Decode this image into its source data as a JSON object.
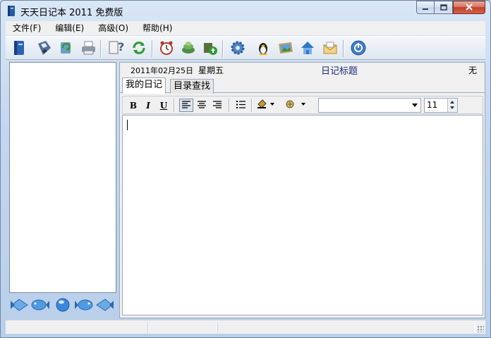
{
  "window": {
    "title": "天天日记本 2011 免费版",
    "controls": {
      "minimize_icon": "minimize-icon",
      "maximize_icon": "maximize-icon",
      "close_icon": "close-icon"
    }
  },
  "menu": [
    {
      "label": "文件(F)"
    },
    {
      "label": "编辑(E)"
    },
    {
      "label": "高级(O)"
    },
    {
      "label": "帮助(H)"
    }
  ],
  "toolbar": {
    "buttons": [
      {
        "icon": "diary-book-icon"
      },
      {
        "icon": "save-disk-icon"
      },
      {
        "icon": "refresh-disk-icon"
      },
      {
        "icon": "printer-icon"
      },
      {
        "icon": "help-lookup-icon"
      },
      {
        "icon": "sync-icon"
      },
      {
        "icon": "alarm-clock-icon"
      },
      {
        "icon": "database-icon"
      },
      {
        "icon": "upload-icon"
      },
      {
        "icon": "settings-gear-icon"
      },
      {
        "icon": "qq-penguin-icon"
      },
      {
        "icon": "picture-frame-icon"
      },
      {
        "icon": "home-icon"
      },
      {
        "icon": "mail-envelope-icon"
      },
      {
        "icon": "power-icon"
      }
    ]
  },
  "navigation": {
    "buttons": [
      "first-fish-icon",
      "previous-fish-icon",
      "today-ball-icon",
      "next-fish-icon",
      "last-fish-icon"
    ]
  },
  "entry": {
    "date": "2011年02月25日",
    "weekday": "星期五",
    "title": "日记标题",
    "category": "无"
  },
  "tabs": [
    {
      "label": "我的日记",
      "active": true
    },
    {
      "label": "目录查找",
      "active": false
    }
  ],
  "format_bar": {
    "bold": "B",
    "italic": "I",
    "underline": "U",
    "font_name": "",
    "font_size": "11"
  },
  "editor": {
    "content": ""
  },
  "status": {
    "cells": [
      "",
      "",
      ""
    ]
  },
  "colors": {
    "accent": "#1a2b7a",
    "frame": "#c3d6ee",
    "close": "#c2402a"
  }
}
